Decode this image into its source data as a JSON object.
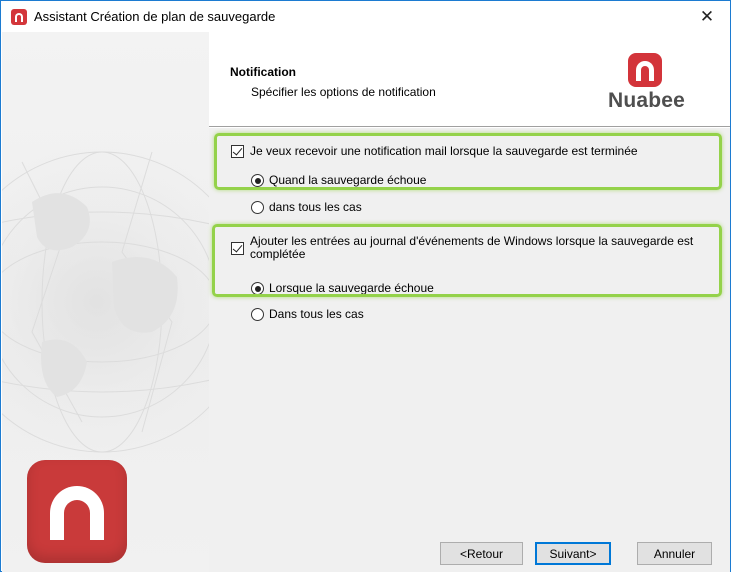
{
  "window": {
    "title": "Assistant Création de plan de sauvegarde",
    "close_glyph": "✕"
  },
  "header": {
    "title": "Notification",
    "subtitle": "Spécifier les options de notification",
    "brand_name": "Nuabee"
  },
  "options": {
    "email_checkbox_label": "Je veux recevoir une notification mail lorsque la sauvegarde est terminée",
    "email_checked": true,
    "email_radio_fail_label": "Quand la sauvegarde échoue",
    "email_radio_all_label": "dans tous les cas",
    "email_selected": "fail",
    "eventlog_checkbox_label": "Ajouter les entrées au journal d'événements de Windows lorsque la sauvegarde est complétée",
    "eventlog_checked": true,
    "eventlog_radio_fail_label": "Lorsque la sauvegarde échoue",
    "eventlog_radio_all_label": "Dans tous les cas",
    "eventlog_selected": "fail"
  },
  "footer": {
    "back_label": "<Retour",
    "next_label": "Suivant>",
    "cancel_label": "Annuler"
  },
  "colors": {
    "brand_red": "#d3343a",
    "highlight_green": "#94d24a",
    "accent_blue": "#0078d7"
  },
  "icons": {
    "app": "nuabee-logo-icon",
    "close": "close-icon"
  }
}
